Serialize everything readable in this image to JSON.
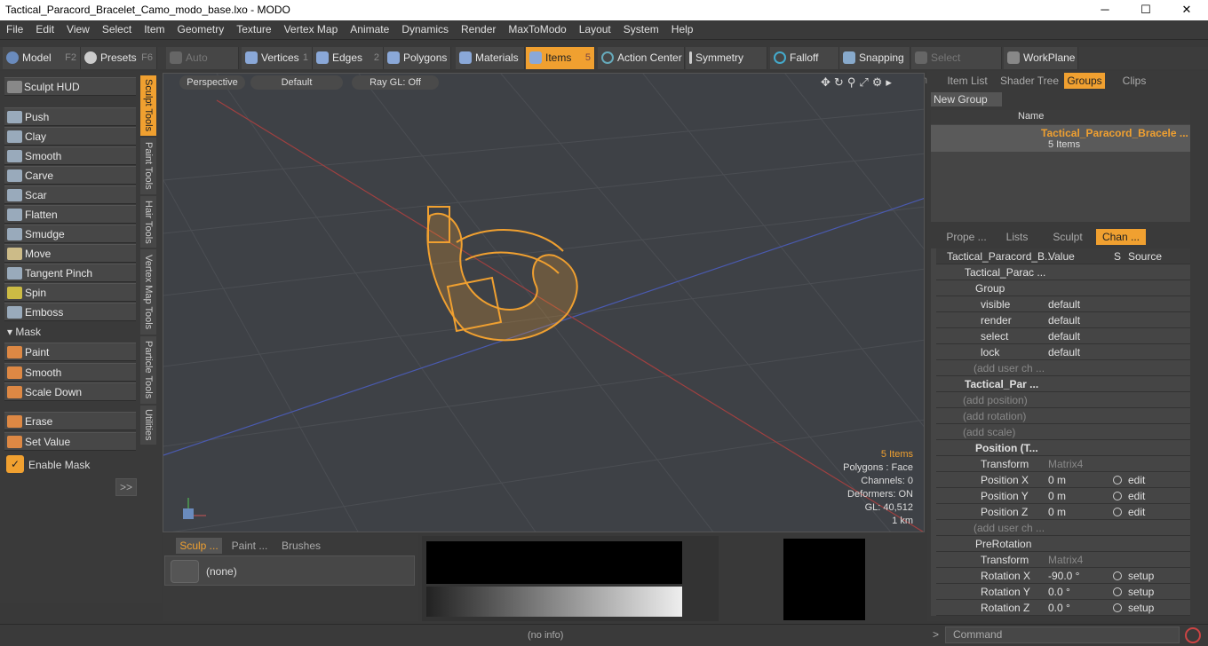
{
  "window": {
    "title": "Tactical_Paracord_Bracelet_Camo_modo_base.lxo - MODO",
    "min": "─",
    "max": "☐",
    "close": "✕"
  },
  "menu": [
    "File",
    "Edit",
    "View",
    "Select",
    "Item",
    "Geometry",
    "Texture",
    "Vertex Map",
    "Animate",
    "Dynamics",
    "Render",
    "MaxToModo",
    "Layout",
    "System",
    "Help"
  ],
  "toolbar": {
    "model": "Model",
    "model_key": "F2",
    "presets": "Presets",
    "presets_key": "F6",
    "auto_select": "Auto Select",
    "vertices": "Vertices",
    "vertices_key": "1",
    "edges": "Edges",
    "edges_key": "2",
    "polygons": "Polygons",
    "materials": "Materials",
    "items": "Items",
    "items_key": "5",
    "action_center": "Action Center",
    "symmetry": "Symmetry",
    "falloff": "Falloff",
    "snapping": "Snapping",
    "select_through": "Select Through",
    "workplane": "WorkPlane"
  },
  "left": {
    "hud": "Sculpt HUD",
    "tools": [
      "Push",
      "Clay",
      "Smooth",
      "Carve",
      "Scar",
      "Flatten",
      "Smudge",
      "Move",
      "Tangent Pinch",
      "Spin",
      "Emboss"
    ],
    "mask_header": "Mask",
    "mask_tools": [
      "Paint",
      "Smooth",
      "Scale Down"
    ],
    "erase": "Erase",
    "set_value": "Set Value",
    "enable_mask": "Enable Mask",
    "more": ">>"
  },
  "vtabs": [
    "Sculpt Tools",
    "Paint Tools",
    "Hair Tools",
    "Vertex Map Tools",
    "Particle Tools",
    "Utilities"
  ],
  "viewport": {
    "view": "Perspective",
    "shading": "Default",
    "raygl": "Ray GL: Off",
    "items": "5 Items",
    "polygons": "Polygons : Face",
    "channels": "Channels: 0",
    "deformers": "Deformers: ON",
    "gl": "GL: 40,512",
    "scale": "1 km"
  },
  "bottom": {
    "tabs": [
      "Sculp ...",
      "Paint ...",
      "Brushes"
    ],
    "brush": "(none)"
  },
  "right": {
    "tabs_top": [
      "Item List",
      "Shader Tree",
      "Groups",
      "Clips"
    ],
    "new_group": "New Group",
    "col_name": "Name",
    "group_name": "Tactical_Paracord_Bracele ...",
    "group_count": "5 Items",
    "tabs_bottom": [
      "Prope ...",
      "Lists",
      "Sculpt",
      "Chan ..."
    ],
    "ch_cols": [
      "Tactical_Paracord_B...",
      "Value",
      "S",
      "Source"
    ],
    "channels": [
      {
        "name": "Tactical_Parac ...",
        "value": "",
        "src": ""
      },
      {
        "name": "Group",
        "value": "",
        "src": ""
      },
      {
        "name": "visible",
        "value": "default",
        "src": ""
      },
      {
        "name": "render",
        "value": "default",
        "src": ""
      },
      {
        "name": "select",
        "value": "default",
        "src": ""
      },
      {
        "name": "lock",
        "value": "default",
        "src": ""
      },
      {
        "name": "(add user ch ...",
        "value": "",
        "src": ""
      },
      {
        "name": "Tactical_Par ...",
        "value": "",
        "src": ""
      },
      {
        "name": "(add position)",
        "value": "",
        "src": ""
      },
      {
        "name": "(add rotation)",
        "value": "",
        "src": ""
      },
      {
        "name": "(add scale)",
        "value": "",
        "src": ""
      },
      {
        "name": "Position (T...",
        "value": "",
        "src": ""
      },
      {
        "name": "Transform",
        "value": "Matrix4",
        "src": ""
      },
      {
        "name": "Position X",
        "value": "0 m",
        "src": "edit"
      },
      {
        "name": "Position Y",
        "value": "0 m",
        "src": "edit"
      },
      {
        "name": "Position Z",
        "value": "0 m",
        "src": "edit"
      },
      {
        "name": "(add user ch ...",
        "value": "",
        "src": ""
      },
      {
        "name": "PreRotation",
        "value": "",
        "src": ""
      },
      {
        "name": "Transform",
        "value": "Matrix4",
        "src": ""
      },
      {
        "name": "Rotation X",
        "value": "-90.0 °",
        "src": "setup"
      },
      {
        "name": "Rotation Y",
        "value": "0.0 °",
        "src": "setup"
      },
      {
        "name": "Rotation Z",
        "value": "0.0 °",
        "src": "setup"
      }
    ]
  },
  "status": {
    "info": "(no info)",
    "command": "Command"
  }
}
